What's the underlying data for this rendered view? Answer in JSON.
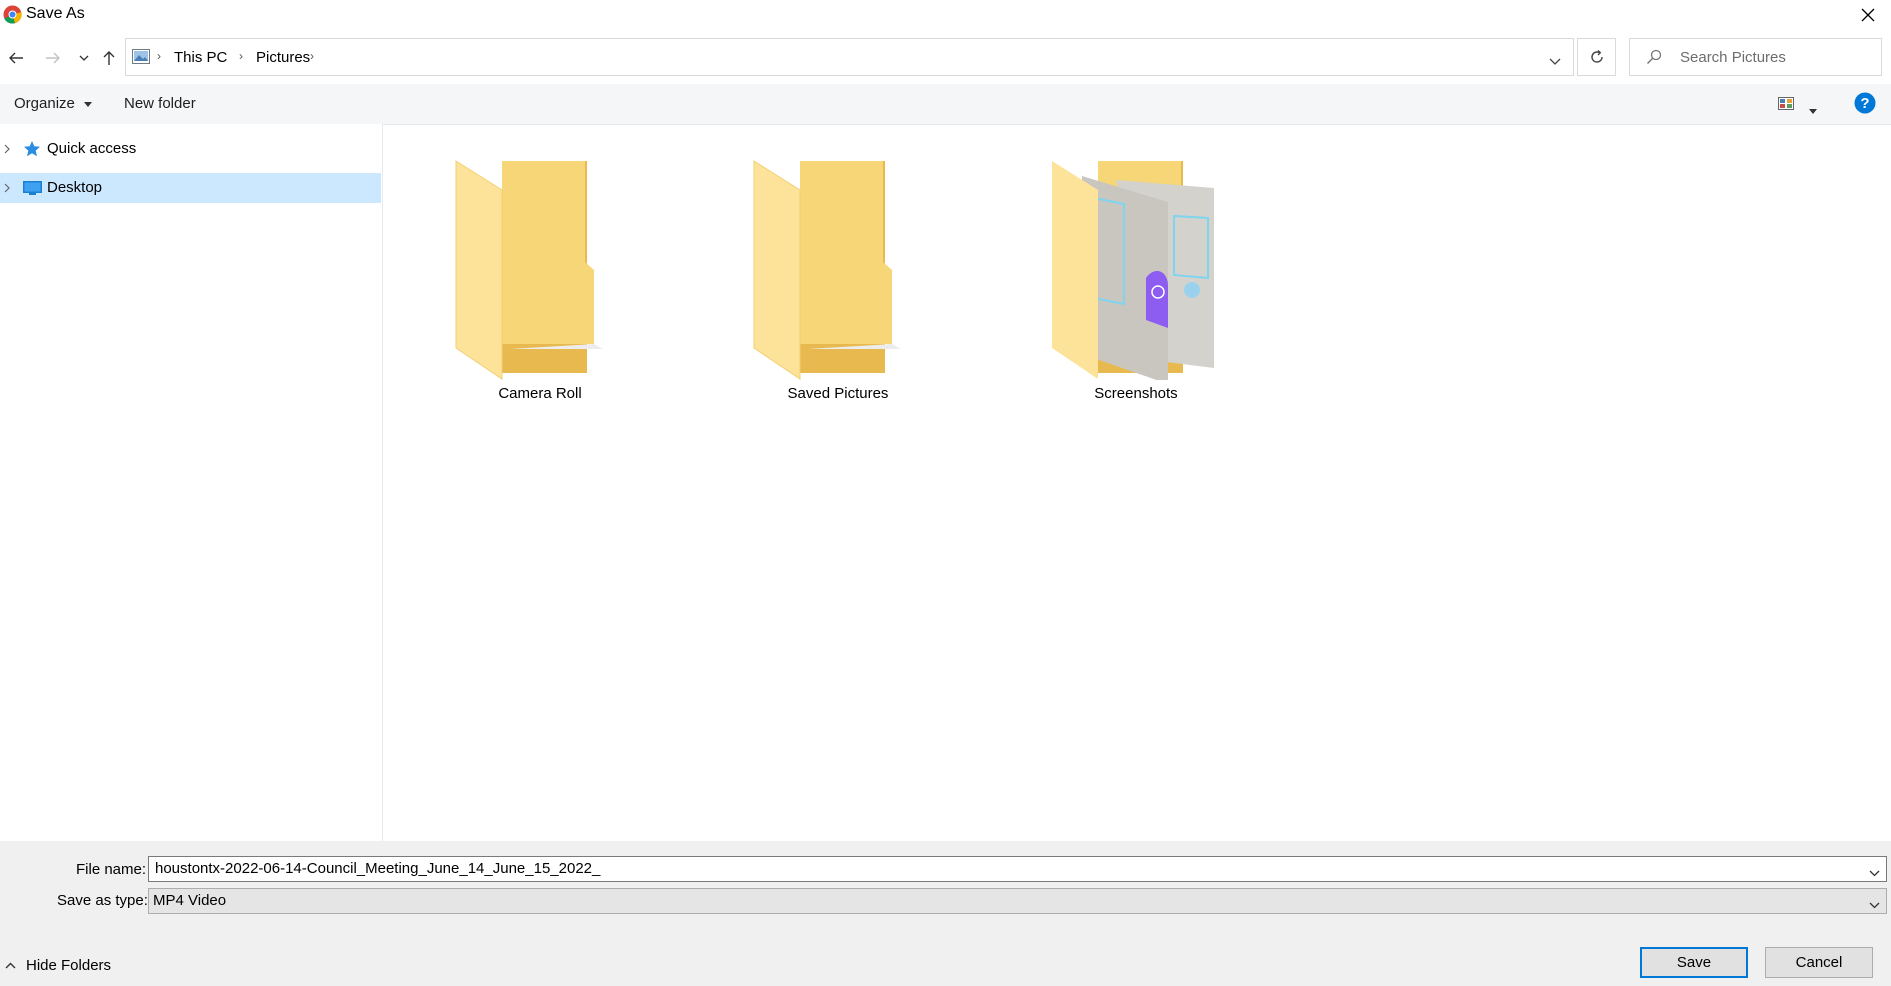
{
  "window": {
    "title": "Save As"
  },
  "address": {
    "crumbs": [
      "This PC",
      "Pictures"
    ]
  },
  "search": {
    "placeholder": "Search Pictures"
  },
  "toolbar": {
    "organize_label": "Organize",
    "new_folder_label": "New folder"
  },
  "sidebar": {
    "items": [
      {
        "label": "Quick access",
        "icon": "star-icon",
        "selected": false
      },
      {
        "label": "Desktop",
        "icon": "desktop-icon",
        "selected": true
      }
    ]
  },
  "folders": [
    {
      "name": "Camera Roll"
    },
    {
      "name": "Saved Pictures"
    },
    {
      "name": "Screenshots"
    }
  ],
  "form": {
    "file_name_label": "File name:",
    "file_name_value": "houstontx-2022-06-14-Council_Meeting_June_14_June_15_2022_",
    "save_type_label": "Save as type:",
    "save_type_value": "MP4 Video"
  },
  "footer": {
    "hide_folders_label": "Hide Folders",
    "save_label": "Save",
    "cancel_label": "Cancel"
  },
  "colors": {
    "accent": "#0078d7",
    "selection": "#cce8ff",
    "folder": "#f6d676"
  }
}
